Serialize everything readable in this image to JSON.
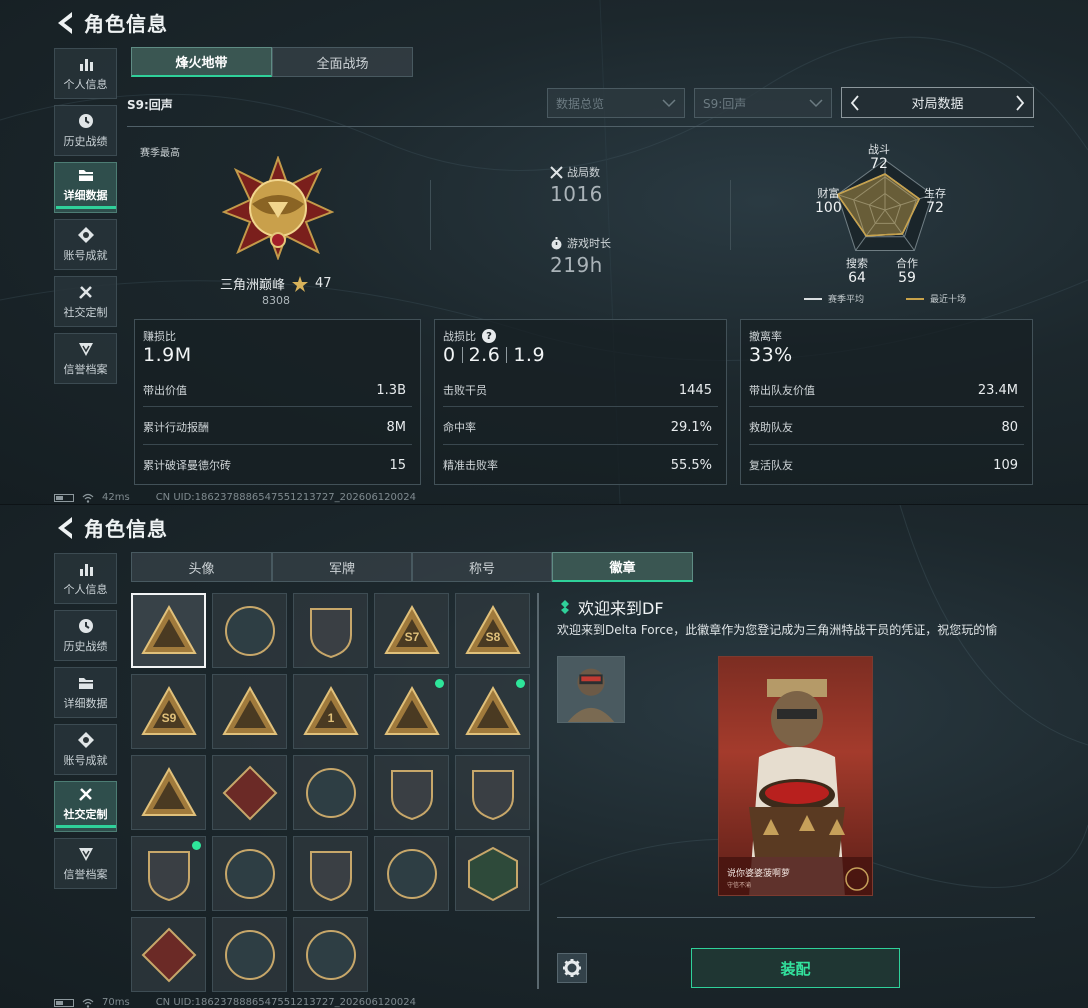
{
  "header": {
    "title": "角色信息"
  },
  "sidebar": {
    "items": [
      {
        "label": "个人信息",
        "icon": "bar-chart-icon"
      },
      {
        "label": "历史战绩",
        "icon": "clock-icon"
      },
      {
        "label": "详细数据",
        "icon": "folder-icon"
      },
      {
        "label": "账号成就",
        "icon": "achievement-icon"
      },
      {
        "label": "社交定制",
        "icon": "tools-icon"
      },
      {
        "label": "信誉档案",
        "icon": "reputation-icon"
      }
    ],
    "active_panel1": "详细数据",
    "active_panel2": "社交定制"
  },
  "stats_panel": {
    "tabs": [
      "烽火地带",
      "全面战场"
    ],
    "active_tab": "烽火地带",
    "season": "S9:回声",
    "filters": {
      "overview": {
        "value": "数据总览"
      },
      "season": {
        "value": "S9:回声"
      }
    },
    "pager_label": "对局数据",
    "season_best_label": "赛季最高",
    "rank": {
      "name": "三角洲巅峰",
      "stars": "47",
      "score": "8308"
    },
    "metrics": {
      "matches": {
        "label": "战局数",
        "value": "1016"
      },
      "play_time": {
        "label": "游戏时长",
        "value": "219h"
      }
    },
    "radar": {
      "axes": [
        {
          "label": "战斗",
          "value": "72"
        },
        {
          "label": "生存",
          "value": "72"
        },
        {
          "label": "合作",
          "value": "59"
        },
        {
          "label": "搜索",
          "value": "64"
        },
        {
          "label": "财富",
          "value": "100"
        }
      ],
      "legend": [
        "赛季平均",
        "最近十场"
      ],
      "colors": {
        "season_avg": "#d9dee0",
        "recent": "#c8a24a"
      }
    },
    "cards": [
      {
        "title": "赚损比",
        "value": "1.9M",
        "rows": [
          {
            "label": "带出价值",
            "value": "1.3B"
          },
          {
            "label": "累计行动报酬",
            "value": "8M"
          },
          {
            "label": "累计破译曼德尔砖",
            "value": "15"
          }
        ]
      },
      {
        "title": "战损比",
        "help": "?",
        "value_parts": [
          "0",
          "2.6",
          "1.9"
        ],
        "rows": [
          {
            "label": "击败干员",
            "value": "1445"
          },
          {
            "label": "命中率",
            "value": "29.1%"
          },
          {
            "label": "精准击败率",
            "value": "55.5%"
          }
        ]
      },
      {
        "title": "撤离率",
        "value": "33%",
        "rows": [
          {
            "label": "带出队友价值",
            "value": "23.4M"
          },
          {
            "label": "救助队友",
            "value": "80"
          },
          {
            "label": "复活队友",
            "value": "109"
          }
        ]
      }
    ],
    "footer": {
      "ping": "42ms",
      "uid": "CN UID:1862378886547551213727_202606120024"
    }
  },
  "customize_panel": {
    "tabs": [
      "头像",
      "军牌",
      "称号",
      "徽章"
    ],
    "active_tab": "徽章",
    "badges": [
      {
        "icon": "triangle-shield-badge-icon",
        "selected": true,
        "new": false
      },
      {
        "icon": "helicopter-badge-icon",
        "selected": false,
        "new": false
      },
      {
        "icon": "diamond-shield-badge-icon",
        "selected": false,
        "new": false
      },
      {
        "icon": "s7-triangle-badge-icon",
        "text": "S7",
        "selected": false,
        "new": false
      },
      {
        "icon": "s8-triangle-badge-icon",
        "text": "S8",
        "selected": false,
        "new": false
      },
      {
        "icon": "s9-triangle-badge-icon",
        "text": "S9",
        "selected": false,
        "new": false
      },
      {
        "icon": "shell-triangle-badge-icon",
        "selected": false,
        "new": false
      },
      {
        "icon": "number-one-triangle-badge-icon",
        "text": "1",
        "selected": false,
        "new": false
      },
      {
        "icon": "cup-triangle-badge-icon",
        "selected": false,
        "new": true
      },
      {
        "icon": "wreath-triangle-badge-icon",
        "selected": false,
        "new": true
      },
      {
        "icon": "camel-triangle-badge-icon",
        "selected": false,
        "new": false
      },
      {
        "icon": "rose-badge-icon",
        "selected": false,
        "new": false
      },
      {
        "icon": "star-medal-badge-icon",
        "selected": false,
        "new": false
      },
      {
        "icon": "wing-shield-badge-icon",
        "selected": false,
        "new": false
      },
      {
        "icon": "ribbon-shield-badge-icon",
        "selected": false,
        "new": false
      },
      {
        "icon": "crest-shield-badge-icon",
        "selected": false,
        "new": true
      },
      {
        "icon": "crosshair-badge-icon",
        "selected": false,
        "new": false
      },
      {
        "icon": "anchor-shield-badge-icon",
        "selected": false,
        "new": false
      },
      {
        "icon": "eagle-badge-icon",
        "selected": false,
        "new": false
      },
      {
        "icon": "wasp-badge-icon",
        "selected": false,
        "new": false
      },
      {
        "icon": "dragon-badge-icon",
        "selected": false,
        "new": false
      },
      {
        "icon": "wolf-badge-icon",
        "selected": false,
        "new": false
      },
      {
        "icon": "wolf-badge-icon",
        "selected": false,
        "new": false
      }
    ],
    "detail": {
      "title": "欢迎来到DF",
      "description": "欢迎来到Delta Force，此徽章作为您登记成为三角洲特战干员的凭证，祝您玩的愉",
      "card_caption": "说你婆婆菠啊萝",
      "card_subcaption": "守信不渝"
    },
    "equip_label": "装配",
    "footer": {
      "ping": "70ms",
      "uid": "CN UID:1862378886547551213727_202606120024"
    }
  }
}
